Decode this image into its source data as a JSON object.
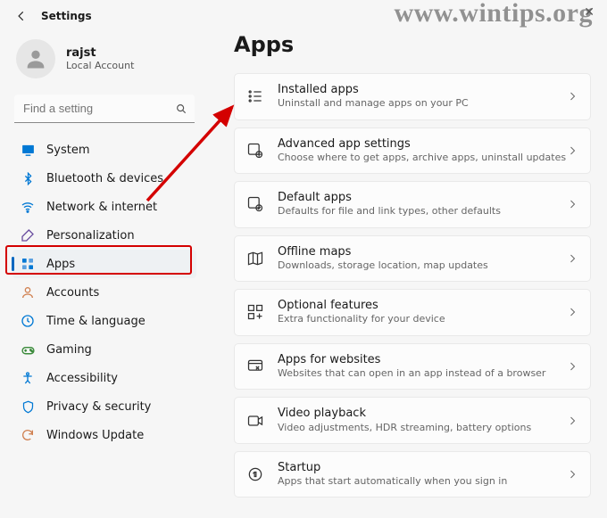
{
  "watermark": "www.wintips.org",
  "window": {
    "title": "Settings"
  },
  "user": {
    "name": "rajst",
    "sub": "Local Account"
  },
  "search": {
    "placeholder": "Find a setting"
  },
  "sidebar": {
    "items": [
      {
        "label": "System"
      },
      {
        "label": "Bluetooth & devices"
      },
      {
        "label": "Network & internet"
      },
      {
        "label": "Personalization"
      },
      {
        "label": "Apps"
      },
      {
        "label": "Accounts"
      },
      {
        "label": "Time & language"
      },
      {
        "label": "Gaming"
      },
      {
        "label": "Accessibility"
      },
      {
        "label": "Privacy & security"
      },
      {
        "label": "Windows Update"
      }
    ]
  },
  "page": {
    "title": "Apps"
  },
  "cards": [
    {
      "title": "Installed apps",
      "sub": "Uninstall and manage apps on your PC"
    },
    {
      "title": "Advanced app settings",
      "sub": "Choose where to get apps, archive apps, uninstall updates"
    },
    {
      "title": "Default apps",
      "sub": "Defaults for file and link types, other defaults"
    },
    {
      "title": "Offline maps",
      "sub": "Downloads, storage location, map updates"
    },
    {
      "title": "Optional features",
      "sub": "Extra functionality for your device"
    },
    {
      "title": "Apps for websites",
      "sub": "Websites that can open in an app instead of a browser"
    },
    {
      "title": "Video playback",
      "sub": "Video adjustments, HDR streaming, battery options"
    },
    {
      "title": "Startup",
      "sub": "Apps that start automatically when you sign in"
    }
  ]
}
